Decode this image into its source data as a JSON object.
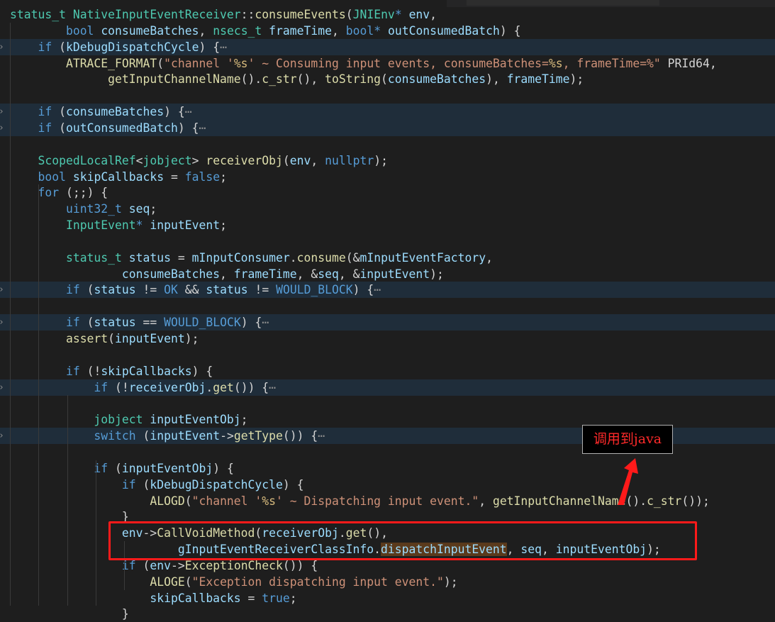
{
  "callout": {
    "text": "调用到java"
  },
  "colors": {
    "annotation": "#ff1a1a",
    "background": "#1e1e1e"
  },
  "lines": [
    [
      [
        "ty",
        "status_t"
      ],
      [
        "plain",
        " "
      ],
      [
        "ty",
        "NativeInputEventReceiver"
      ],
      [
        "plain",
        "::"
      ],
      [
        "fn",
        "consumeEvents"
      ],
      [
        "plain",
        "("
      ],
      [
        "ty",
        "JNIEnv"
      ],
      [
        "kw",
        "*"
      ],
      [
        "plain",
        " "
      ],
      [
        "var",
        "env"
      ],
      [
        "plain",
        ","
      ]
    ],
    [
      [
        "plain",
        "        "
      ],
      [
        "kw",
        "bool"
      ],
      [
        "plain",
        " "
      ],
      [
        "var",
        "consumeBatches"
      ],
      [
        "plain",
        ", "
      ],
      [
        "ty",
        "nsecs_t"
      ],
      [
        "plain",
        " "
      ],
      [
        "var",
        "frameTime"
      ],
      [
        "plain",
        ", "
      ],
      [
        "kw",
        "bool"
      ],
      [
        "kw",
        "*"
      ],
      [
        "plain",
        " "
      ],
      [
        "var",
        "outConsumedBatch"
      ],
      [
        "plain",
        ") {"
      ]
    ],
    [
      [
        "plain",
        "    "
      ],
      [
        "kw",
        "if"
      ],
      [
        "plain",
        " ("
      ],
      [
        "var",
        "kDebugDispatchCycle"
      ],
      [
        "plain",
        ") {"
      ],
      [
        "fold",
        "⋯"
      ]
    ],
    [
      [
        "plain",
        "        "
      ],
      [
        "fn",
        "ATRACE_FORMAT"
      ],
      [
        "plain",
        "("
      ],
      [
        "str",
        "\"channel '"
      ],
      [
        "esc",
        "%s"
      ],
      [
        "str",
        "' ~ Consuming input events, consumeBatches="
      ],
      [
        "esc",
        "%s"
      ],
      [
        "str",
        ", frameTime=%\""
      ],
      [
        "plain",
        " PRId64,"
      ]
    ],
    [
      [
        "plain",
        "              "
      ],
      [
        "fn",
        "getInputChannelName"
      ],
      [
        "plain",
        "()."
      ],
      [
        "fn",
        "c_str"
      ],
      [
        "plain",
        "(), "
      ],
      [
        "fn",
        "toString"
      ],
      [
        "plain",
        "("
      ],
      [
        "var",
        "consumeBatches"
      ],
      [
        "plain",
        "), "
      ],
      [
        "var",
        "frameTime"
      ],
      [
        "plain",
        ");"
      ]
    ],
    [],
    [
      [
        "plain",
        "    "
      ],
      [
        "kw",
        "if"
      ],
      [
        "plain",
        " ("
      ],
      [
        "var",
        "consumeBatches"
      ],
      [
        "plain",
        ") {"
      ],
      [
        "fold",
        "⋯"
      ]
    ],
    [
      [
        "plain",
        "    "
      ],
      [
        "kw",
        "if"
      ],
      [
        "plain",
        " ("
      ],
      [
        "var",
        "outConsumedBatch"
      ],
      [
        "plain",
        ") {"
      ],
      [
        "fold",
        "⋯"
      ]
    ],
    [],
    [
      [
        "plain",
        "    "
      ],
      [
        "ty",
        "ScopedLocalRef"
      ],
      [
        "plain",
        "<"
      ],
      [
        "ty",
        "jobject"
      ],
      [
        "plain",
        "> "
      ],
      [
        "fn",
        "receiverObj"
      ],
      [
        "plain",
        "("
      ],
      [
        "var",
        "env"
      ],
      [
        "plain",
        ", "
      ],
      [
        "kw",
        "nullptr"
      ],
      [
        "plain",
        ");"
      ]
    ],
    [
      [
        "plain",
        "    "
      ],
      [
        "kw",
        "bool"
      ],
      [
        "plain",
        " "
      ],
      [
        "var",
        "skipCallbacks"
      ],
      [
        "plain",
        " = "
      ],
      [
        "kw",
        "false"
      ],
      [
        "plain",
        ";"
      ]
    ],
    [
      [
        "plain",
        "    "
      ],
      [
        "kw",
        "for"
      ],
      [
        "plain",
        " (;;) {"
      ]
    ],
    [
      [
        "plain",
        "        "
      ],
      [
        "kw",
        "uint32_t"
      ],
      [
        "plain",
        " "
      ],
      [
        "var",
        "seq"
      ],
      [
        "plain",
        ";"
      ]
    ],
    [
      [
        "plain",
        "        "
      ],
      [
        "ty",
        "InputEvent"
      ],
      [
        "kw",
        "*"
      ],
      [
        "plain",
        " "
      ],
      [
        "var",
        "inputEvent"
      ],
      [
        "plain",
        ";"
      ]
    ],
    [],
    [
      [
        "plain",
        "        "
      ],
      [
        "ty",
        "status_t"
      ],
      [
        "plain",
        " "
      ],
      [
        "var",
        "status"
      ],
      [
        "plain",
        " = "
      ],
      [
        "var",
        "mInputConsumer"
      ],
      [
        "plain",
        "."
      ],
      [
        "fn",
        "consume"
      ],
      [
        "plain",
        "(&"
      ],
      [
        "var",
        "mInputEventFactory"
      ],
      [
        "plain",
        ","
      ]
    ],
    [
      [
        "plain",
        "                "
      ],
      [
        "var",
        "consumeBatches"
      ],
      [
        "plain",
        ", "
      ],
      [
        "var",
        "frameTime"
      ],
      [
        "plain",
        ", &"
      ],
      [
        "var",
        "seq"
      ],
      [
        "plain",
        ", &"
      ],
      [
        "var",
        "inputEvent"
      ],
      [
        "plain",
        ");"
      ]
    ],
    [
      [
        "plain",
        "        "
      ],
      [
        "kw",
        "if"
      ],
      [
        "plain",
        " ("
      ],
      [
        "var",
        "status"
      ],
      [
        "plain",
        " != "
      ],
      [
        "mac",
        "OK"
      ],
      [
        "plain",
        " && "
      ],
      [
        "var",
        "status"
      ],
      [
        "plain",
        " != "
      ],
      [
        "mac",
        "WOULD_BLOCK"
      ],
      [
        "plain",
        ") {"
      ],
      [
        "fold",
        "⋯"
      ]
    ],
    [],
    [
      [
        "plain",
        "        "
      ],
      [
        "kw",
        "if"
      ],
      [
        "plain",
        " ("
      ],
      [
        "var",
        "status"
      ],
      [
        "plain",
        " == "
      ],
      [
        "mac",
        "WOULD_BLOCK"
      ],
      [
        "plain",
        ") {"
      ],
      [
        "fold",
        "⋯"
      ]
    ],
    [
      [
        "plain",
        "        "
      ],
      [
        "fn",
        "assert"
      ],
      [
        "plain",
        "("
      ],
      [
        "var",
        "inputEvent"
      ],
      [
        "plain",
        ");"
      ]
    ],
    [],
    [
      [
        "plain",
        "        "
      ],
      [
        "kw",
        "if"
      ],
      [
        "plain",
        " (!"
      ],
      [
        "var",
        "skipCallbacks"
      ],
      [
        "plain",
        ") {"
      ]
    ],
    [
      [
        "plain",
        "            "
      ],
      [
        "kw",
        "if"
      ],
      [
        "plain",
        " (!"
      ],
      [
        "var",
        "receiverObj"
      ],
      [
        "plain",
        "."
      ],
      [
        "fn",
        "get"
      ],
      [
        "plain",
        "()) {"
      ],
      [
        "fold",
        "⋯"
      ]
    ],
    [],
    [
      [
        "plain",
        "            "
      ],
      [
        "ty",
        "jobject"
      ],
      [
        "plain",
        " "
      ],
      [
        "var",
        "inputEventObj"
      ],
      [
        "plain",
        ";"
      ]
    ],
    [
      [
        "plain",
        "            "
      ],
      [
        "kw",
        "switch"
      ],
      [
        "plain",
        " ("
      ],
      [
        "var",
        "inputEvent"
      ],
      [
        "plain",
        "->"
      ],
      [
        "fn",
        "getType"
      ],
      [
        "plain",
        "()) {"
      ],
      [
        "fold",
        "⋯"
      ]
    ],
    [],
    [
      [
        "plain",
        "            "
      ],
      [
        "kw",
        "if"
      ],
      [
        "plain",
        " ("
      ],
      [
        "var",
        "inputEventObj"
      ],
      [
        "plain",
        ") {"
      ]
    ],
    [
      [
        "plain",
        "                "
      ],
      [
        "kw",
        "if"
      ],
      [
        "plain",
        " ("
      ],
      [
        "var",
        "kDebugDispatchCycle"
      ],
      [
        "plain",
        ") {"
      ]
    ],
    [
      [
        "plain",
        "                    "
      ],
      [
        "fn",
        "ALOGD"
      ],
      [
        "plain",
        "("
      ],
      [
        "str",
        "\"channel '"
      ],
      [
        "esc",
        "%s"
      ],
      [
        "str",
        "' ~ Dispatching input event.\""
      ],
      [
        "plain",
        ", "
      ],
      [
        "fn",
        "getInputChannelName"
      ],
      [
        "plain",
        "()."
      ],
      [
        "fn",
        "c_str"
      ],
      [
        "plain",
        "());"
      ]
    ],
    [
      [
        "plain",
        "                }"
      ]
    ],
    [
      [
        "plain",
        "                "
      ],
      [
        "var",
        "env"
      ],
      [
        "plain",
        "->"
      ],
      [
        "fn",
        "CallVoidMethod"
      ],
      [
        "plain",
        "("
      ],
      [
        "var",
        "receiverObj"
      ],
      [
        "plain",
        "."
      ],
      [
        "fn",
        "get"
      ],
      [
        "plain",
        "(),"
      ]
    ],
    [
      [
        "plain",
        "                        "
      ],
      [
        "var",
        "gInputEventReceiverClassInfo"
      ],
      [
        "plain",
        "."
      ],
      [
        "hlvar",
        "dispatchInputEvent"
      ],
      [
        "plain",
        ", "
      ],
      [
        "var",
        "seq"
      ],
      [
        "plain",
        ", "
      ],
      [
        "var",
        "inputEventObj"
      ],
      [
        "plain",
        ");"
      ]
    ],
    [
      [
        "plain",
        "                "
      ],
      [
        "kw",
        "if"
      ],
      [
        "plain",
        " ("
      ],
      [
        "var",
        "env"
      ],
      [
        "plain",
        "->"
      ],
      [
        "fn",
        "ExceptionCheck"
      ],
      [
        "plain",
        "()) {"
      ]
    ],
    [
      [
        "plain",
        "                    "
      ],
      [
        "fn",
        "ALOGE"
      ],
      [
        "plain",
        "("
      ],
      [
        "str",
        "\"Exception dispatching input event.\""
      ],
      [
        "plain",
        ");"
      ]
    ],
    [
      [
        "plain",
        "                    "
      ],
      [
        "var",
        "skipCallbacks"
      ],
      [
        "plain",
        " = "
      ],
      [
        "kw",
        "true"
      ],
      [
        "plain",
        ";"
      ]
    ],
    [
      [
        "plain",
        "                }"
      ]
    ]
  ],
  "highlighted_lines": [
    2,
    6,
    7,
    17,
    19,
    23,
    26
  ],
  "fold_markers": [
    2,
    6,
    7,
    17,
    19,
    23,
    26
  ]
}
